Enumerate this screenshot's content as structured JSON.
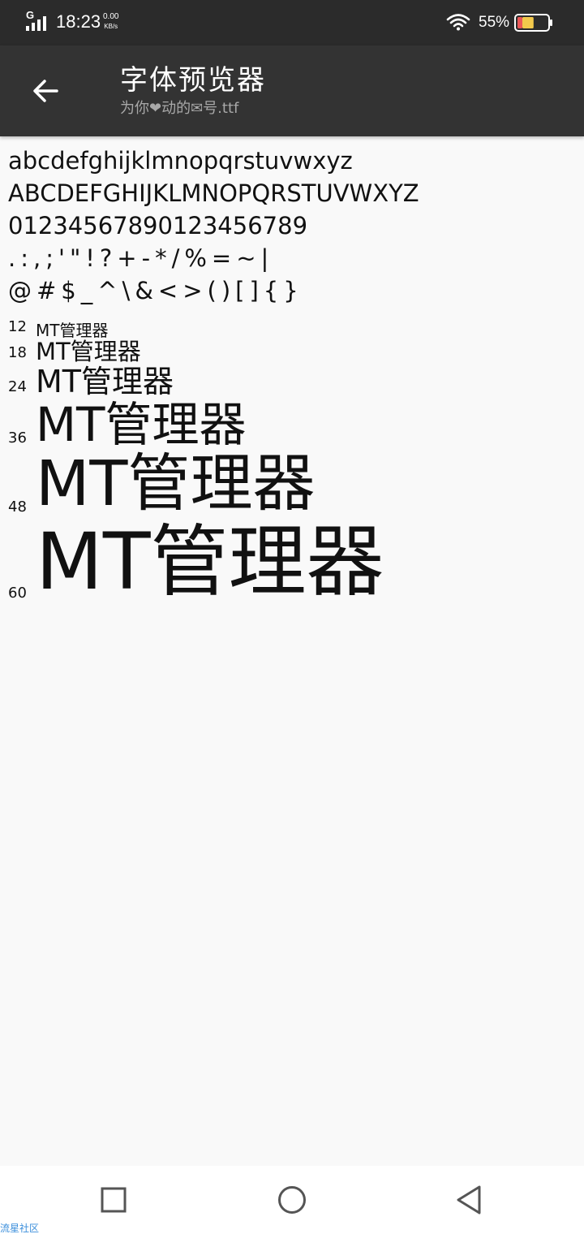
{
  "status_bar": {
    "network": "G",
    "time": "18:23",
    "speed_value": "0.00",
    "speed_unit": "KB/s",
    "battery": "55%",
    "battery_level": 0.55,
    "battery_color": "#f2c94c",
    "battery_low_color": "#eb5757"
  },
  "app_bar": {
    "title": "字体预览器",
    "subtitle": "为你❤动的✉号.ttf",
    "back_icon": "arrow-left-icon"
  },
  "preview": {
    "lowercase": "abcdefghijklmnopqrstuvwxyz",
    "uppercase": "ABCDEFGHIJKLMNOPQRSTUVWXYZ",
    "digits": "01234567890123456789",
    "punctuation": ".:,;'\"!?+-*/%=~|",
    "symbols": "@#$_^\\&<>()[]{}",
    "sizes": [
      {
        "label": "12",
        "text": "MT管理器"
      },
      {
        "label": "18",
        "text": "MT管理器"
      },
      {
        "label": "24",
        "text": "MT管理器"
      },
      {
        "label": "36",
        "text": "MT管理器"
      },
      {
        "label": "48",
        "text": "MT管理器"
      },
      {
        "label": "60",
        "text": "MT管理器"
      }
    ]
  },
  "nav_bar": {
    "recents_icon": "square-icon",
    "home_icon": "circle-icon",
    "back_icon": "triangle-back-icon"
  },
  "watermark": "流星社区"
}
